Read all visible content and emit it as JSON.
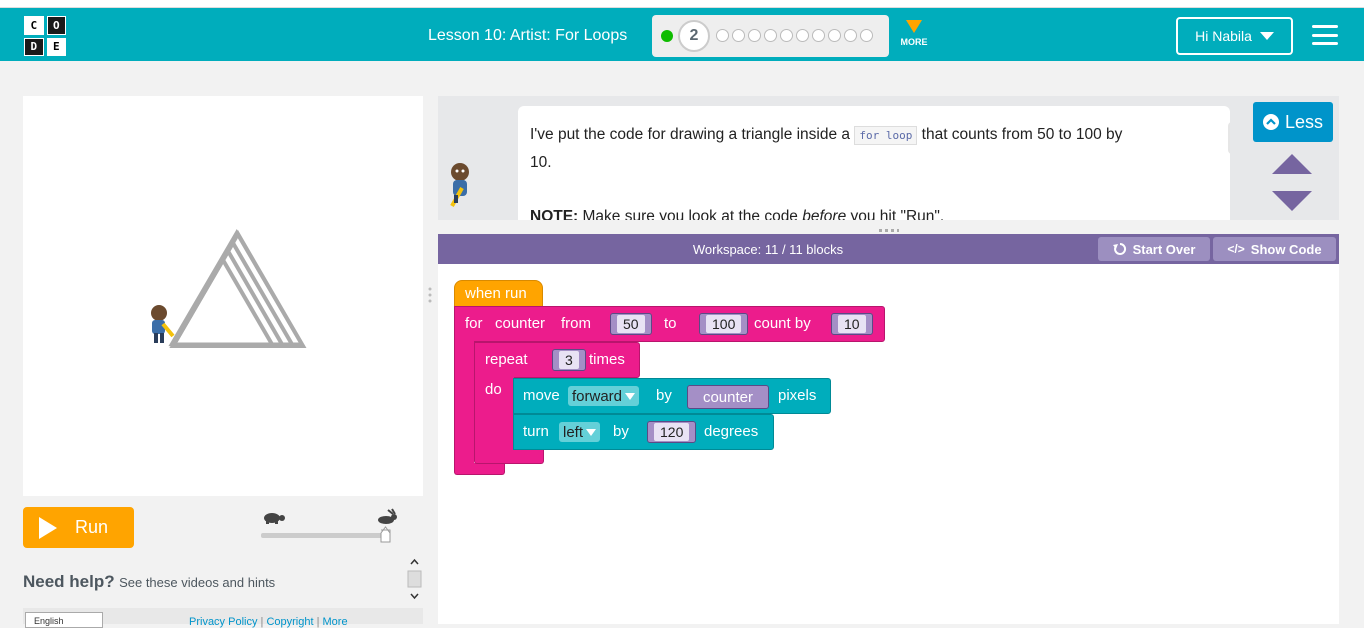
{
  "header": {
    "logo_letters": [
      "C",
      "O",
      "D",
      "E"
    ],
    "lesson_title": "Lesson 10: Artist: For Loops",
    "current_level": "2",
    "remaining_levels": 10,
    "more_label": "MORE",
    "user_label": "Hi Nabila",
    "colors": {
      "header_bg": "#00adbc",
      "accent": "#ffa400",
      "done": "#0fbc00"
    }
  },
  "visualization": {
    "run_label": "Run",
    "speed_slow_icon": "turtle-icon",
    "speed_fast_icon": "rabbit-icon",
    "speed_level": 1.0
  },
  "help": {
    "title": "Need help?",
    "subtitle": "See these videos and hints"
  },
  "footer": {
    "language": "English",
    "links": [
      "Privacy Policy",
      "Copyright",
      "More"
    ]
  },
  "instructions": {
    "text_before_code": "I've put the code for drawing a triangle inside a ",
    "code_text": "for loop",
    "text_after_code": " that counts from 50 to 100 by 10.",
    "note_label": "NOTE:",
    "note_text_1": " Make sure you look at the code ",
    "note_emphasis": "before",
    "note_text_2": " you hit \"Run\".",
    "less_label": "Less"
  },
  "workspace": {
    "title": "Workspace: 11 / 11 blocks",
    "start_over_label": "Start Over",
    "show_code_label": "Show Code",
    "colors": {
      "event": "#ffa400",
      "loop": "#ec1c8c",
      "draw": "#00adbc",
      "variable": "#a48fc6"
    }
  },
  "blocks": {
    "when_run": "when run",
    "for_label": "for",
    "for_var": "counter",
    "from_label": "from",
    "from_value": "50",
    "to_label": "to",
    "to_value": "100",
    "count_by_label": "count by",
    "count_by_value": "10",
    "repeat_label": "repeat",
    "repeat_value": "3",
    "times_label": "times",
    "do_label": "do",
    "move_label": "move",
    "move_dir": "forward",
    "by_label": "by",
    "move_var": "counter",
    "pixels_label": "pixels",
    "turn_label": "turn",
    "turn_dir": "left",
    "turn_by_label": "by",
    "turn_value": "120",
    "degrees_label": "degrees"
  }
}
